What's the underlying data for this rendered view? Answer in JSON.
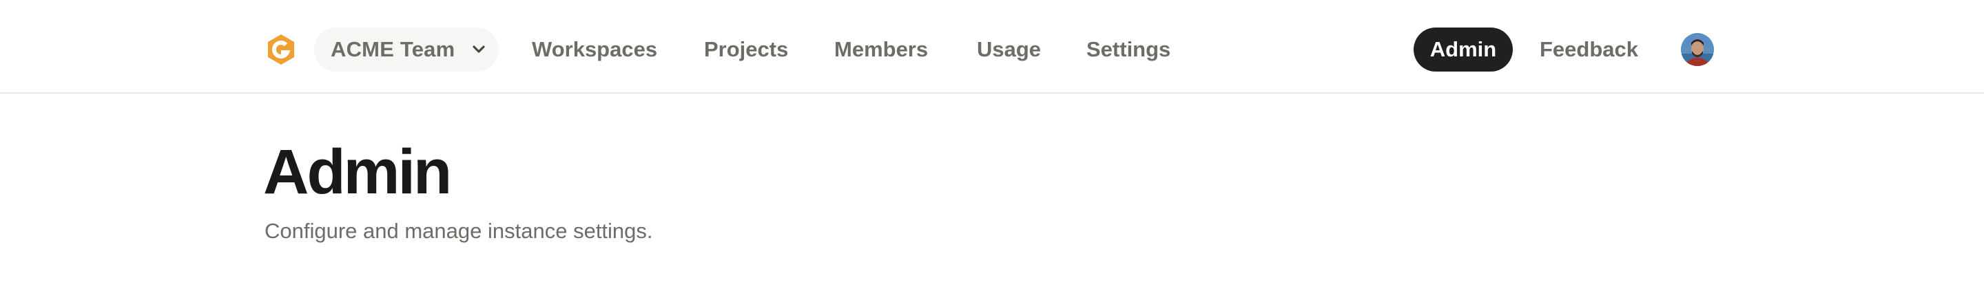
{
  "header": {
    "team_switcher": {
      "label": "ACME Team",
      "icon": "chevron-down-icon"
    },
    "nav": [
      {
        "label": "Workspaces"
      },
      {
        "label": "Projects"
      },
      {
        "label": "Members"
      },
      {
        "label": "Usage"
      },
      {
        "label": "Settings"
      }
    ],
    "admin_label": "Admin",
    "feedback_label": "Feedback",
    "logo_icon": "app-logo-icon",
    "avatar_icon": "user-avatar",
    "accent_color": "#f0a030",
    "active_pill_color": "#22201f"
  },
  "main": {
    "title": "Admin",
    "subtitle": "Configure and manage instance settings."
  }
}
